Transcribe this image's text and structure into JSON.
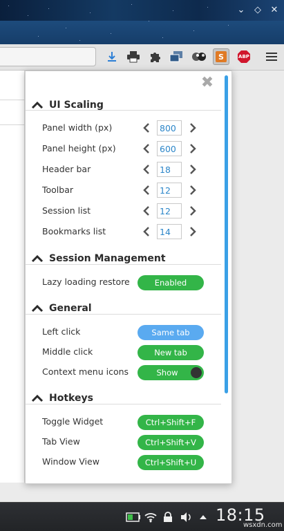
{
  "popup": {
    "sections": [
      {
        "title": "UI Scaling",
        "rows": [
          {
            "label": "Panel width (px)",
            "value": "800"
          },
          {
            "label": "Panel height (px)",
            "value": "600"
          },
          {
            "label": "Header bar",
            "value": "18"
          },
          {
            "label": "Toolbar",
            "value": "12"
          },
          {
            "label": "Session list",
            "value": "12"
          },
          {
            "label": "Bookmarks list",
            "value": "14"
          }
        ]
      },
      {
        "title": "Session Management",
        "rows": [
          {
            "label": "Lazy loading restore",
            "toggle": "Enabled"
          }
        ]
      },
      {
        "title": "General",
        "rows": [
          {
            "label": "Left click",
            "toggle": "Same tab"
          },
          {
            "label": "Middle click",
            "toggle": "New tab"
          },
          {
            "label": "Context menu icons",
            "toggle": "Show"
          }
        ]
      },
      {
        "title": "Hotkeys",
        "rows": [
          {
            "label": "Toggle Widget",
            "toggle": "Ctrl+Shift+F"
          },
          {
            "label": "Tab View",
            "toggle": "Ctrl+Shift+V"
          },
          {
            "label": "Window View",
            "toggle": "Ctrl+Shift+U"
          }
        ]
      }
    ]
  },
  "extension_icons": {
    "abp_label": "ABP",
    "session_badge": "S"
  },
  "taskbar": {
    "clock": "18:15",
    "watermark": "wsxdn.com"
  },
  "colors": {
    "accent_blue": "#3aa0e6",
    "pill_green": "#33b548",
    "pill_blue": "#5aaaf0",
    "input_text": "#2c86c9"
  }
}
